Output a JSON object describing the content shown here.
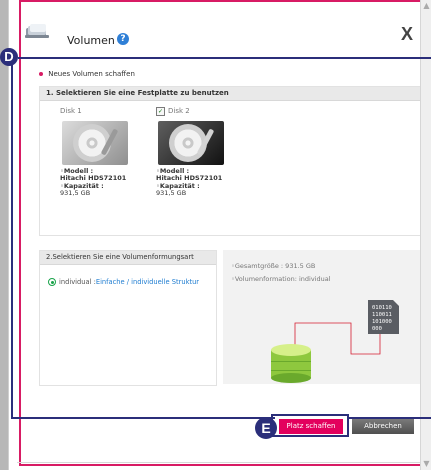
{
  "dialog": {
    "title": "Volumen",
    "help_icon": "help-icon",
    "close_label": "X"
  },
  "callouts": {
    "d": "D",
    "e": "E"
  },
  "main": {
    "new_volume_label": "Neues Volumen schaffen",
    "step1_heading": "1. Selektieren Sie eine Festplatte zu benutzen",
    "disks": [
      {
        "name": "Disk 1",
        "checked": false,
        "model_label": "Modell :",
        "model_value": "Hitachi HDS72101",
        "capacity_label": "Kapazität :",
        "capacity_value": "931,5 GB"
      },
      {
        "name": "Disk 2",
        "checked": true,
        "model_label": "Modell :",
        "model_value": "Hitachi HDS72101",
        "capacity_label": "Kapazität :",
        "capacity_value": "931,5 GB"
      }
    ],
    "step2_heading": "2.Selektieren Sie eine Volumenformungsart",
    "radio_option": {
      "label_prefix": "individual : ",
      "label_link": "Einfache / individuelle Struktur"
    }
  },
  "info": {
    "total_size": "Gesamtgröße : 931.5 GB",
    "formation": "Volumenformation: individual",
    "binary_text": [
      "010110",
      "110011",
      "101000",
      "000"
    ]
  },
  "buttons": {
    "create": "Platz schaffen",
    "cancel": "Abbrechen"
  },
  "colors": {
    "accent": "#e3005d",
    "callout": "#2b2e7a",
    "link": "#1f7dd1",
    "selected": "#19a34a"
  }
}
